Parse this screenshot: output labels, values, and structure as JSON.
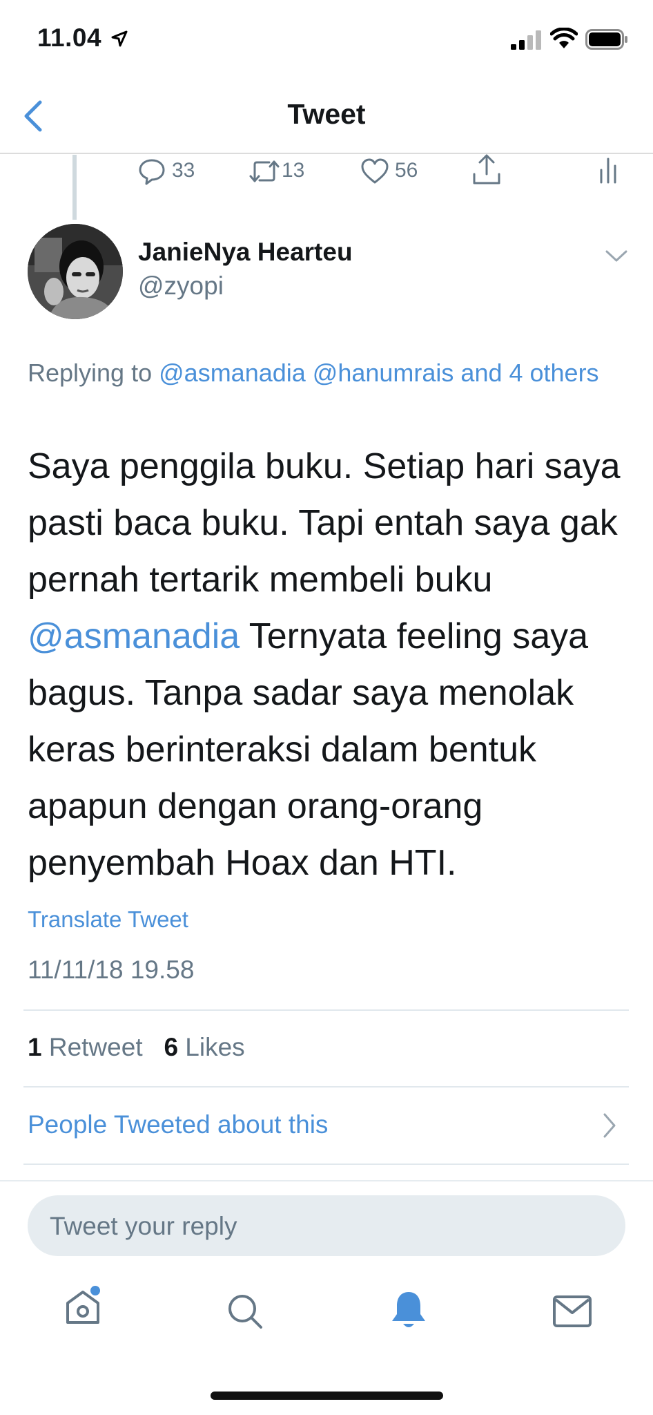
{
  "status_bar": {
    "time": "11.04"
  },
  "nav": {
    "title": "Tweet"
  },
  "parent_actions": {
    "replies": "33",
    "retweets": "13",
    "likes": "56"
  },
  "tweet": {
    "display_name": "JanieNya Hearteu",
    "handle": "@zyopi",
    "replying_prefix": "Replying to",
    "replying_to": "@asmanadia @hanumrais and 4 others",
    "body_before": "Saya penggila buku. Setiap hari saya pasti baca buku. Tapi entah saya gak pernah tertarik membeli buku ",
    "body_mention": "@asmanadia",
    "body_after": " Ternyata feeling saya bagus. Tanpa sadar saya menolak keras berinteraksi dalam bentuk apapun dengan orang-orang penyembah Hoax dan HTI.",
    "translate": "Translate Tweet",
    "timestamp": "11/11/18 19.58",
    "retweet_count": "1",
    "retweet_label": "Retweet",
    "like_count": "6",
    "like_label": "Likes",
    "people_link": "People Tweeted about this"
  },
  "reply": {
    "placeholder": "Tweet your reply"
  },
  "tab_bar": {
    "items": [
      "home-icon",
      "search-icon",
      "notifications-icon",
      "messages-icon"
    ],
    "active": "notifications-icon"
  },
  "colors": {
    "accent": "#4a90d9",
    "secondary_text": "#657786",
    "primary_text": "#14171a"
  }
}
